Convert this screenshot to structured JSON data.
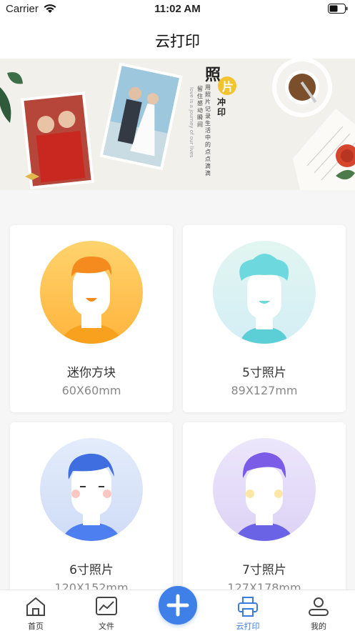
{
  "status_bar": {
    "carrier": "Carrier",
    "time": "11:02 AM"
  },
  "nav": {
    "title": "云打印"
  },
  "banner": {
    "headline": "照",
    "badge": "片",
    "subtitle": "冲印",
    "column1": "用照片记录生活中的点点滴滴",
    "column2": "留住感动瞬间"
  },
  "products": [
    {
      "name": "迷你方块",
      "size": "60X60mm"
    },
    {
      "name": "5寸照片",
      "size": "89X127mm"
    },
    {
      "name": "6寸照片",
      "size": "120X152mm"
    },
    {
      "name": "7寸照片",
      "size": "127X178mm"
    }
  ],
  "tabs": [
    {
      "label": "首页"
    },
    {
      "label": "文件"
    },
    {
      "label": "云打印"
    },
    {
      "label": "我的"
    }
  ],
  "colors": {
    "accent": "#3f7fe8",
    "active_tab": "#3a7be0"
  }
}
